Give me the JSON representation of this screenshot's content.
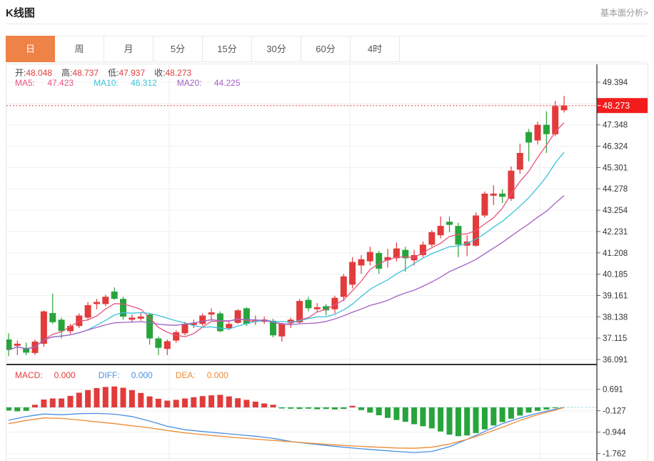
{
  "header": {
    "title": "K线图",
    "link_label": "基本面分析>"
  },
  "tabs": {
    "items": [
      "日",
      "周",
      "月",
      "5分",
      "15分",
      "30分",
      "60分",
      "4时"
    ],
    "selected_index": 0
  },
  "info_bar": {
    "items": [
      {
        "label": "开:",
        "value": "48.048"
      },
      {
        "label": "高:",
        "value": "48.737"
      },
      {
        "label": "低:",
        "value": "47.937"
      },
      {
        "label": "收:",
        "value": "48.273"
      }
    ]
  },
  "ma_bar": {
    "items": [
      {
        "label": "MA5:",
        "value": "47.423",
        "color": "#e8537f"
      },
      {
        "label": "MA10:",
        "value": "46.312",
        "color": "#3bc2da"
      },
      {
        "label": "MA20:",
        "value": "44.225",
        "color": "#a261c5"
      }
    ]
  },
  "macd_bar": {
    "items": [
      {
        "label": "MACD:",
        "value": "0.000",
        "color": "#e23b3b"
      },
      {
        "label": "DIFF:",
        "value": "0.000",
        "color": "#4a90e2"
      },
      {
        "label": "DEA:",
        "value": "0.000",
        "color": "#ee8c35"
      }
    ]
  },
  "colors": {
    "up": "#e23b3b",
    "down": "#28a43c",
    "selected_tab": "#ef8247",
    "last_price_box": "#f21c1c",
    "grid": "#efefef",
    "axis": "#333333"
  },
  "chart_data": {
    "type": "candlestick",
    "panes": [
      "price",
      "macd"
    ],
    "grid_on": true,
    "up_color": "#e23b3b",
    "down_color": "#28a43c",
    "ylim_price": [
      36.091,
      49.394
    ],
    "ylim_macd": [
      -1.762,
      0.691
    ],
    "candles": [
      [
        37.05,
        37.35,
        36.25,
        36.55
      ],
      [
        36.75,
        37.0,
        36.3,
        36.85
      ],
      [
        36.65,
        36.9,
        36.3,
        36.42
      ],
      [
        36.4,
        37.05,
        36.3,
        36.95
      ],
      [
        36.85,
        38.45,
        36.7,
        38.4
      ],
      [
        38.32,
        39.25,
        37.8,
        37.88
      ],
      [
        38.0,
        38.1,
        37.1,
        37.45
      ],
      [
        37.45,
        37.8,
        37.3,
        37.7
      ],
      [
        37.7,
        38.3,
        37.6,
        38.2
      ],
      [
        38.1,
        38.85,
        38.0,
        38.7
      ],
      [
        38.75,
        39.0,
        38.5,
        38.85
      ],
      [
        38.75,
        39.2,
        38.65,
        39.1
      ],
      [
        39.35,
        39.55,
        38.95,
        39.0
      ],
      [
        39.0,
        39.1,
        38.0,
        38.15
      ],
      [
        38.0,
        38.25,
        37.9,
        38.1
      ],
      [
        38.05,
        38.35,
        37.95,
        38.15
      ],
      [
        38.25,
        38.3,
        36.8,
        37.1
      ],
      [
        37.1,
        37.2,
        36.3,
        36.65
      ],
      [
        36.6,
        37.05,
        36.3,
        36.97
      ],
      [
        37.0,
        37.5,
        36.9,
        37.4
      ],
      [
        37.35,
        37.9,
        37.25,
        37.8
      ],
      [
        37.75,
        38.0,
        37.6,
        37.85
      ],
      [
        37.8,
        38.3,
        37.7,
        38.2
      ],
      [
        38.25,
        38.55,
        37.95,
        38.35
      ],
      [
        38.3,
        38.4,
        37.4,
        37.45
      ],
      [
        37.6,
        37.95,
        37.5,
        37.8
      ],
      [
        37.85,
        38.5,
        37.8,
        38.45
      ],
      [
        38.55,
        38.6,
        37.7,
        37.8
      ],
      [
        37.95,
        38.2,
        37.75,
        38.0
      ],
      [
        37.9,
        38.15,
        37.8,
        38.0
      ],
      [
        37.95,
        38.05,
        37.15,
        37.25
      ],
      [
        37.2,
        37.85,
        36.95,
        37.8
      ],
      [
        37.85,
        38.1,
        37.6,
        38.0
      ],
      [
        37.87,
        39.0,
        37.8,
        38.9
      ],
      [
        38.95,
        39.1,
        38.4,
        38.55
      ],
      [
        38.5,
        38.8,
        38.35,
        38.6
      ],
      [
        38.65,
        38.75,
        38.2,
        38.45
      ],
      [
        38.5,
        39.15,
        38.3,
        39.05
      ],
      [
        39.1,
        40.2,
        38.9,
        40.08
      ],
      [
        39.68,
        41.0,
        39.5,
        40.77
      ],
      [
        40.6,
        41.1,
        40.2,
        40.9
      ],
      [
        40.8,
        41.5,
        40.6,
        41.25
      ],
      [
        41.2,
        41.3,
        40.2,
        40.45
      ],
      [
        40.85,
        41.4,
        40.5,
        41.0
      ],
      [
        40.95,
        41.7,
        40.8,
        41.42
      ],
      [
        41.35,
        41.5,
        40.3,
        40.95
      ],
      [
        40.85,
        41.35,
        40.6,
        41.1
      ],
      [
        41.1,
        41.75,
        41.0,
        41.6
      ],
      [
        41.6,
        42.3,
        41.5,
        42.2
      ],
      [
        42.05,
        42.95,
        41.9,
        42.5
      ],
      [
        42.7,
        42.95,
        42.2,
        42.55
      ],
      [
        42.5,
        42.65,
        41.0,
        41.6
      ],
      [
        41.55,
        42.05,
        41.05,
        41.75
      ],
      [
        41.55,
        43.15,
        41.5,
        43.0
      ],
      [
        43.0,
        44.15,
        42.9,
        44.05
      ],
      [
        43.95,
        44.45,
        43.5,
        44.05
      ],
      [
        44.05,
        44.25,
        43.6,
        43.9
      ],
      [
        43.8,
        45.35,
        43.7,
        45.15
      ],
      [
        45.2,
        46.45,
        45.0,
        46.0
      ],
      [
        47.0,
        47.15,
        45.6,
        46.5
      ],
      [
        46.6,
        47.5,
        46.4,
        47.35
      ],
      [
        47.35,
        48.0,
        46.0,
        46.9
      ],
      [
        46.9,
        48.5,
        46.8,
        48.25
      ],
      [
        48.048,
        48.737,
        47.937,
        48.273
      ]
    ],
    "last_price": 48.273,
    "last_price_label": "48.273",
    "ma_periods": [
      5,
      10,
      20
    ],
    "ma_colors": [
      "#e8537f",
      "#3bc2da",
      "#a261c5"
    ],
    "price_gridlines": [
      {
        "value": 49.394,
        "label": "49.394"
      },
      {
        "value": 48.371,
        "label": ""
      },
      {
        "value": 47.348,
        "label": "47.348"
      },
      {
        "value": 46.324,
        "label": "46.324"
      },
      {
        "value": 45.301,
        "label": "45.301"
      },
      {
        "value": 44.278,
        "label": "44.278"
      },
      {
        "value": 43.254,
        "label": "43.254"
      },
      {
        "value": 42.231,
        "label": "42.231"
      },
      {
        "value": 41.208,
        "label": "41.208"
      },
      {
        "value": 40.185,
        "label": "40.185"
      },
      {
        "value": 39.161,
        "label": "39.161"
      },
      {
        "value": 38.138,
        "label": "38.138"
      },
      {
        "value": 37.115,
        "label": "37.115"
      },
      {
        "value": 36.091,
        "label": "36.091"
      }
    ],
    "macd_hist": [
      -0.12,
      -0.15,
      -0.13,
      0.1,
      0.3,
      0.34,
      0.34,
      0.44,
      0.56,
      0.66,
      0.74,
      0.78,
      0.8,
      0.75,
      0.66,
      0.55,
      0.42,
      0.33,
      0.26,
      0.29,
      0.34,
      0.39,
      0.43,
      0.46,
      0.48,
      0.42,
      0.35,
      0.29,
      0.22,
      0.15,
      0.1,
      -0.04,
      -0.05,
      -0.06,
      -0.05,
      -0.07,
      -0.06,
      -0.08,
      -0.06,
      0.06,
      -0.1,
      -0.2,
      -0.3,
      -0.4,
      -0.48,
      -0.55,
      -0.64,
      -0.72,
      -0.8,
      -0.92,
      -1.04,
      -1.1,
      -1.07,
      -0.98,
      -0.84,
      -0.69,
      -0.56,
      -0.43,
      -0.31,
      -0.2,
      -0.13,
      -0.08,
      -0.03,
      0.0
    ],
    "diff_color": "#4a90e2",
    "dea_color": "#ee8c35",
    "diff_points": [
      [
        0,
        -0.49
      ],
      [
        2,
        -0.35
      ],
      [
        4,
        -0.25
      ],
      [
        6,
        -0.28
      ],
      [
        8,
        -0.24
      ],
      [
        10,
        -0.23
      ],
      [
        12,
        -0.26
      ],
      [
        14,
        -0.35
      ],
      [
        16,
        -0.52
      ],
      [
        18,
        -0.72
      ],
      [
        20,
        -0.85
      ],
      [
        22,
        -0.92
      ],
      [
        24,
        -0.98
      ],
      [
        26,
        -1.04
      ],
      [
        28,
        -1.1
      ],
      [
        30,
        -1.18
      ],
      [
        32,
        -1.3
      ],
      [
        34,
        -1.38
      ],
      [
        36,
        -1.45
      ],
      [
        38,
        -1.52
      ],
      [
        40,
        -1.58
      ],
      [
        42,
        -1.63
      ],
      [
        44,
        -1.68
      ],
      [
        46,
        -1.72
      ],
      [
        48,
        -1.68
      ],
      [
        50,
        -1.5
      ],
      [
        52,
        -1.22
      ],
      [
        54,
        -0.92
      ],
      [
        56,
        -0.62
      ],
      [
        58,
        -0.4
      ],
      [
        60,
        -0.22
      ],
      [
        62,
        -0.07
      ],
      [
        63,
        0.0
      ]
    ],
    "dea_points": [
      [
        0,
        -0.62
      ],
      [
        2,
        -0.5
      ],
      [
        4,
        -0.4
      ],
      [
        6,
        -0.42
      ],
      [
        8,
        -0.48
      ],
      [
        10,
        -0.55
      ],
      [
        12,
        -0.62
      ],
      [
        14,
        -0.7
      ],
      [
        16,
        -0.78
      ],
      [
        18,
        -0.88
      ],
      [
        20,
        -0.97
      ],
      [
        22,
        -1.04
      ],
      [
        24,
        -1.1
      ],
      [
        26,
        -1.16
      ],
      [
        28,
        -1.21
      ],
      [
        30,
        -1.26
      ],
      [
        32,
        -1.31
      ],
      [
        34,
        -1.36
      ],
      [
        36,
        -1.41
      ],
      [
        38,
        -1.45
      ],
      [
        40,
        -1.49
      ],
      [
        42,
        -1.52
      ],
      [
        44,
        -1.55
      ],
      [
        46,
        -1.56
      ],
      [
        48,
        -1.52
      ],
      [
        50,
        -1.4
      ],
      [
        52,
        -1.22
      ],
      [
        54,
        -1.0
      ],
      [
        56,
        -0.76
      ],
      [
        58,
        -0.5
      ],
      [
        60,
        -0.28
      ],
      [
        62,
        -0.1
      ],
      [
        63,
        0.0
      ]
    ],
    "macd_gridlines": [
      {
        "value": 0.691,
        "label": "0.691"
      },
      {
        "value": -0.127,
        "label": "-0.127"
      },
      {
        "value": -0.944,
        "label": "-0.944"
      },
      {
        "value": -1.762,
        "label": "-1.762"
      }
    ]
  }
}
